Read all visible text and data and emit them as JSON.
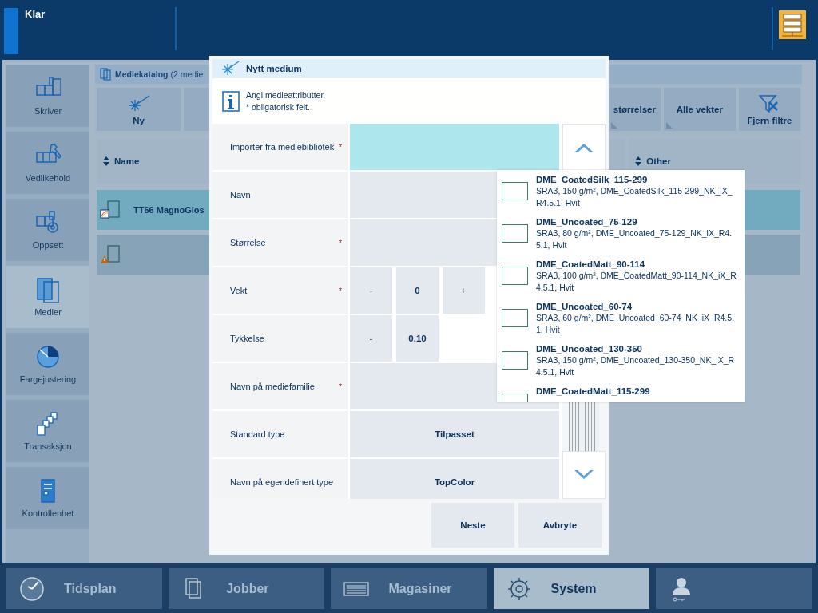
{
  "header": {
    "status": "Klar"
  },
  "sidebar": {
    "items": [
      {
        "label": "Skriver",
        "kind": "printer",
        "selected": false
      },
      {
        "label": "Vedlikehold",
        "kind": "maintenance",
        "selected": false
      },
      {
        "label": "Oppsett",
        "kind": "setup",
        "selected": false
      },
      {
        "label": "Medier",
        "kind": "media",
        "selected": true
      },
      {
        "label": "Fargejustering",
        "kind": "color",
        "selected": false
      },
      {
        "label": "Transaksjon",
        "kind": "transaction",
        "selected": false
      },
      {
        "label": "Kontrollenhet",
        "kind": "controller",
        "selected": false
      }
    ]
  },
  "catalog": {
    "title": "**Mediekatalog** (2 medie",
    "toolbar": [
      {
        "label": "Ny",
        "kind": "new"
      },
      {
        "kind": "blank"
      },
      {
        "label": "størrelser",
        "kind": "filter"
      },
      {
        "label": "Alle vekter",
        "kind": "filter"
      },
      {
        "label": "Fjern filtre",
        "kind": "clear"
      }
    ],
    "columns": [
      "Name",
      "Other"
    ],
    "rows": [
      {
        "name": "TT66 MagnoGlos",
        "kind": "colored",
        "selected": true
      },
      {
        "kind": "warning",
        "selected": false
      }
    ]
  },
  "modal": {
    "title": "Nytt medium",
    "info": [
      "Angi medieattributter.",
      "* obligatorisk felt."
    ],
    "rows": [
      {
        "label": "Importer fra mediebibliotek",
        "mark": "*",
        "kind": "field",
        "active": true
      },
      {
        "label": "Navn",
        "kind": "field",
        "active": false
      },
      {
        "label": "Størrelse",
        "mark": "*",
        "kind": "field",
        "active": false
      },
      {
        "label": "Vekt",
        "mark": "*",
        "kind": "stepper",
        "parts": [
          {
            "text": "-",
            "kind": "button",
            "disabled": true
          },
          {
            "text": "0",
            "kind": "value"
          },
          {
            "text": "+",
            "kind": "button",
            "disabled": true
          }
        ]
      },
      {
        "label": "Tykkelse",
        "kind": "stepper",
        "parts": [
          {
            "text": "-",
            "kind": "button",
            "disabled": false
          },
          {
            "text": "0.10",
            "kind": "value"
          }
        ]
      },
      {
        "label": "Navn på mediefamilie",
        "mark": "*",
        "kind": "field",
        "active": false
      },
      {
        "label": "Standard type",
        "kind": "select",
        "value": "Tilpasset"
      },
      {
        "label": "Navn på egendefinert type",
        "kind": "select",
        "value": "TopColor"
      }
    ],
    "buttons": [
      "Neste",
      "Avbryte"
    ]
  },
  "dropdown": {
    "items": [
      {
        "title": "DME_CoatedSilk_115-299",
        "detail": "SRA3, 150 g/m², DME_CoatedSilk_115-299_NK_iX_R4.5.1, Hvit",
        "checked": false
      },
      {
        "title": "DME_Uncoated_75-129",
        "detail": "SRA3, 80 g/m², DME_Uncoated_75-129_NK_iX_R4.5.1, Hvit",
        "checked": false
      },
      {
        "title": "DME_CoatedMatt_90-114",
        "detail": "SRA3, 100 g/m², DME_CoatedMatt_90-114_NK_iX_R4.5.1, Hvit",
        "checked": false
      },
      {
        "title": "DME_Uncoated_60-74",
        "detail": "SRA3, 60 g/m², DME_Uncoated_60-74_NK_iX_R4.5.1, Hvit",
        "checked": false
      },
      {
        "title": "DME_Uncoated_130-350",
        "detail": "SRA3, 150 g/m², DME_Uncoated_130-350_NK_iX_R4.5.1, Hvit",
        "checked": false
      },
      {
        "title": "DME_CoatedMatt_115-299",
        "checked": false
      }
    ]
  },
  "taskbar": {
    "items": [
      {
        "label": "Tidsplan",
        "kind": "clock",
        "selected": false
      },
      {
        "label": "Jobber",
        "kind": "jobs",
        "selected": false
      },
      {
        "label": "Magasiner",
        "kind": "trays",
        "selected": false
      },
      {
        "label": "System",
        "kind": "system",
        "selected": true
      },
      {
        "kind": "user",
        "selected": false
      }
    ]
  }
}
